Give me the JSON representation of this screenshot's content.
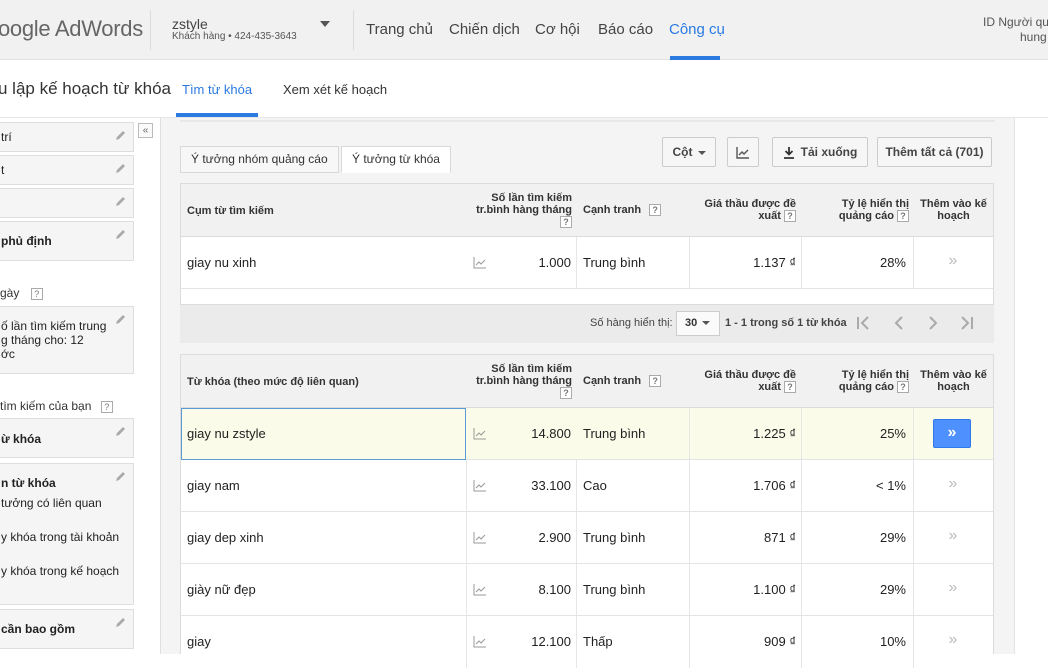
{
  "topbar": {
    "logo": "oogle AdWords",
    "account_name": "zstyle",
    "account_sub": "Khách hàng  •  424-435-3643",
    "nav": [
      "Trang chủ",
      "Chiến dịch",
      "Cơ hội",
      "Báo cáo",
      "Công cụ"
    ],
    "active_nav": "Công cụ",
    "user_line1": "ID Người qu",
    "user_line2": "hung"
  },
  "subbar": {
    "title": "u lập kế hoạch từ khóa",
    "tabs": [
      "Tìm từ khóa",
      "Xem xét kế hoạch"
    ],
    "active_tab": "Tìm từ khóa"
  },
  "sidebar": {
    "box1": "trí",
    "box2": "t",
    "box4": "phủ định",
    "label_date": "gày",
    "box5_line1": "ố lần tìm kiếm trung",
    "box5_line2": "g tháng cho: 12",
    "box5_line3": "ớc",
    "label_search": "tìm kiếm của bạn",
    "box6": "ừ khóa",
    "box7_title": "n từ khóa",
    "box7_line1": "tưởng có liên quan",
    "box7_line2": "y khóa trong tài khoản",
    "box7_line3": "y khóa trong kế hoạch",
    "box8": "cần bao gồm",
    "collapse": "«"
  },
  "main": {
    "tabs": [
      "Ý tưởng nhóm quảng cáo",
      "Ý tưởng từ khóa"
    ],
    "active_tab": "Ý tưởng từ khóa",
    "columns_btn": "Cột",
    "download_btn": "Tải xuống",
    "add_all_btn": "Thêm tất cả (701)"
  },
  "table1": {
    "headers": {
      "term": "Cụm từ tìm kiếm",
      "searches_l1": "Số lần tìm kiếm",
      "searches_l2": "tr.bình hàng tháng",
      "competition": "Cạnh tranh",
      "bid_l1": "Giá thầu được đề",
      "bid_l2": "xuất",
      "share_l1": "Tỷ lệ hiển thị",
      "share_l2": "quảng cáo",
      "add_l1": "Thêm vào kế",
      "add_l2": "hoạch"
    },
    "rows": [
      {
        "term": "giay nu xinh",
        "searches": "1.000",
        "competition": "Trung bình",
        "bid": "1.137 ₫",
        "share": "28%"
      }
    ]
  },
  "pager": {
    "rows_label": "Số hàng hiển thị:",
    "rows_value": "30",
    "range_text": "1 - 1 trong số 1 từ khóa"
  },
  "table2": {
    "headers": {
      "term": "Từ khóa (theo mức độ liên quan)",
      "searches_l1": "Số lần tìm kiếm",
      "searches_l2": "tr.bình hàng tháng",
      "competition": "Cạnh tranh",
      "bid_l1": "Giá thầu được đề",
      "bid_l2": "xuất",
      "share_l1": "Tỷ lệ hiển thị",
      "share_l2": "quảng cáo",
      "add_l1": "Thêm vào kế",
      "add_l2": "hoạch"
    },
    "rows": [
      {
        "term": "giay nu zstyle",
        "searches": "14.800",
        "competition": "Trung bình",
        "bid": "1.225 ₫",
        "share": "25%"
      },
      {
        "term": "giay nam",
        "searches": "33.100",
        "competition": "Cao",
        "bid": "1.706 ₫",
        "share": "< 1%"
      },
      {
        "term": "giay dep xinh",
        "searches": "2.900",
        "competition": "Trung bình",
        "bid": "871 ₫",
        "share": "29%"
      },
      {
        "term": "giày nữ đẹp",
        "searches": "8.100",
        "competition": "Trung bình",
        "bid": "1.100 ₫",
        "share": "29%"
      },
      {
        "term": "giay",
        "searches": "12.100",
        "competition": "Thấp",
        "bid": "909 ₫",
        "share": "10%"
      }
    ]
  },
  "icons": {
    "add": "»",
    "help": "?"
  },
  "colors": {
    "accent": "#2a7ae2",
    "primary_button": "#4d90fe",
    "highlight_row": "#fbfbe9"
  }
}
